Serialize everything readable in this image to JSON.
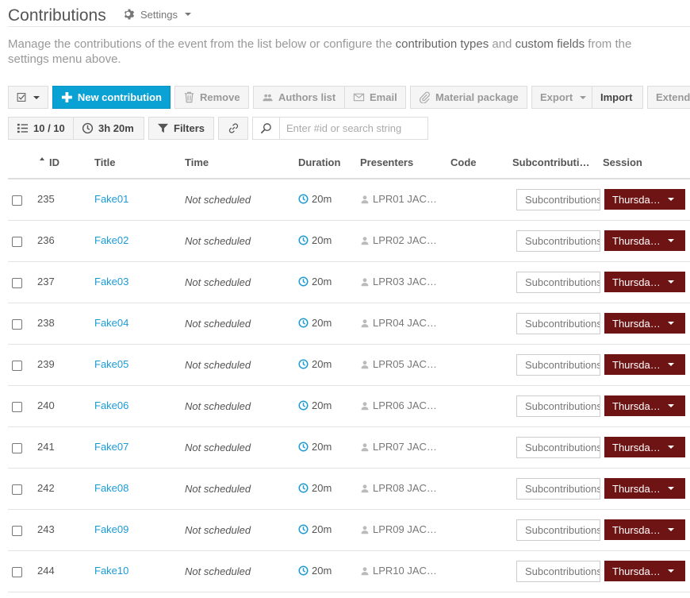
{
  "header": {
    "title": "Contributions",
    "settings_label": "Settings"
  },
  "intro": {
    "part1": "Manage the contributions of the event from the list below or configure the ",
    "link1": "contribution types",
    "part2": " and ",
    "link2": "custom fields",
    "part3": " from the settings menu above."
  },
  "toolbar": {
    "new_contribution": "New contribution",
    "remove": "Remove",
    "authors_list": "Authors list",
    "email": "Email",
    "material_package": "Material package",
    "export": "Export",
    "import": "Import",
    "extended": "Extende"
  },
  "filters": {
    "count": "10 / 10",
    "duration": "3h 20m",
    "filters_label": "Filters",
    "search_placeholder": "Enter #id or search string"
  },
  "table": {
    "columns": [
      "ID",
      "Title",
      "Time",
      "Duration",
      "Presenters",
      "Code",
      "Subcontributi…",
      "Session"
    ],
    "subcontrib_label": "Subcontributions",
    "rows": [
      {
        "id": "235",
        "title": "Fake01",
        "time": "Not scheduled",
        "duration": "20m",
        "presenter": "LPR01 JAC…",
        "session": "Thursda…"
      },
      {
        "id": "236",
        "title": "Fake02",
        "time": "Not scheduled",
        "duration": "20m",
        "presenter": "LPR02 JAC…",
        "session": "Thursda…"
      },
      {
        "id": "237",
        "title": "Fake03",
        "time": "Not scheduled",
        "duration": "20m",
        "presenter": "LPR03 JAC…",
        "session": "Thursda…"
      },
      {
        "id": "238",
        "title": "Fake04",
        "time": "Not scheduled",
        "duration": "20m",
        "presenter": "LPR04 JAC…",
        "session": "Thursda…"
      },
      {
        "id": "239",
        "title": "Fake05",
        "time": "Not scheduled",
        "duration": "20m",
        "presenter": "LPR05 JAC…",
        "session": "Thursda…"
      },
      {
        "id": "240",
        "title": "Fake06",
        "time": "Not scheduled",
        "duration": "20m",
        "presenter": "LPR06 JAC…",
        "session": "Thursda…"
      },
      {
        "id": "241",
        "title": "Fake07",
        "time": "Not scheduled",
        "duration": "20m",
        "presenter": "LPR07 JAC…",
        "session": "Thursda…"
      },
      {
        "id": "242",
        "title": "Fake08",
        "time": "Not scheduled",
        "duration": "20m",
        "presenter": "LPR08 JAC…",
        "session": "Thursda…"
      },
      {
        "id": "243",
        "title": "Fake09",
        "time": "Not scheduled",
        "duration": "20m",
        "presenter": "LPR09 JAC…",
        "session": "Thursda…"
      },
      {
        "id": "244",
        "title": "Fake10",
        "time": "Not scheduled",
        "duration": "20m",
        "presenter": "LPR10 JAC…",
        "session": "Thursda…"
      }
    ]
  },
  "colors": {
    "primary": "#0aa1d5",
    "link": "#1a9bd7",
    "session": "#6e1414"
  }
}
